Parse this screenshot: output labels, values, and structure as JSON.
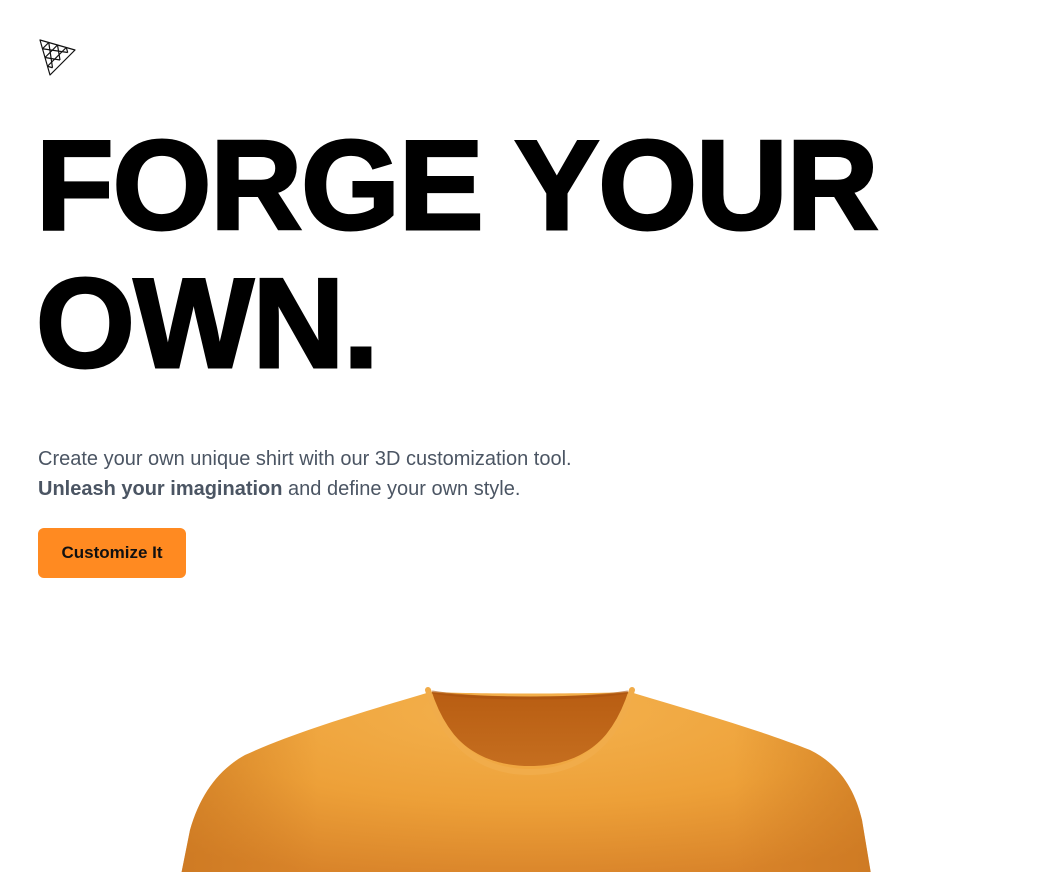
{
  "header": {
    "logo_icon": "threejs-triangle-logo-icon"
  },
  "hero": {
    "headline_line1": "FORGE YOUR",
    "headline_line2": "OWN.",
    "description_prefix": "Create your own unique shirt with our 3D customization tool.",
    "description_emphasis": "Unleash your imagination",
    "description_suffix": "and define your own style.",
    "cta_label": "Customize It"
  },
  "shirt_preview": {
    "icon": "tshirt-3d-model-icon",
    "color": "#EFA33F"
  },
  "colors": {
    "accent": "#FF8A21",
    "headline": "#000000",
    "body_text": "#4B5563"
  }
}
